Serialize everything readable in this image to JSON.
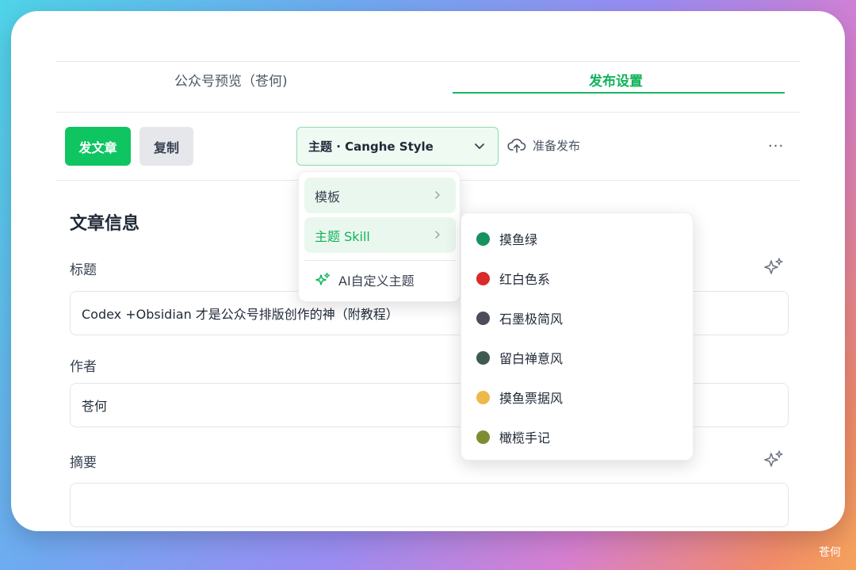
{
  "tabs": [
    {
      "label": "公众号预览（苍何)",
      "active": false
    },
    {
      "label": "发布设置",
      "active": true
    }
  ],
  "toolbar": {
    "publish_label": "发文章",
    "copy_label": "复制",
    "theme_select_value": "主题 · Canghe Style",
    "prepare_label": "准备发布",
    "more_label": "···"
  },
  "article_info": {
    "section_title": "文章信息",
    "title_label": "标题",
    "title_value": "Codex +Obsidian 才是公众号排版创作的神（附教程）",
    "author_label": "作者",
    "author_value": "苍何",
    "summary_label": "摘要"
  },
  "theme_menu": {
    "items": [
      "模板",
      "主题 Skill"
    ],
    "ai_item": "AI自定义主题"
  },
  "skill_submenu": [
    {
      "label": "摸鱼绿",
      "color": "#16925e"
    },
    {
      "label": "红白色系",
      "color": "#d92a2a"
    },
    {
      "label": "石墨极简风",
      "color": "#4b4d5a"
    },
    {
      "label": "留白禅意风",
      "color": "#3f5a4e"
    },
    {
      "label": "摸鱼票据风",
      "color": "#efb84a"
    },
    {
      "label": "橄榄手记",
      "color": "#7f8c33"
    }
  ],
  "colors": {
    "accent": "#0fc562",
    "accent_text": "#10b45a"
  },
  "watermark": "苍何"
}
